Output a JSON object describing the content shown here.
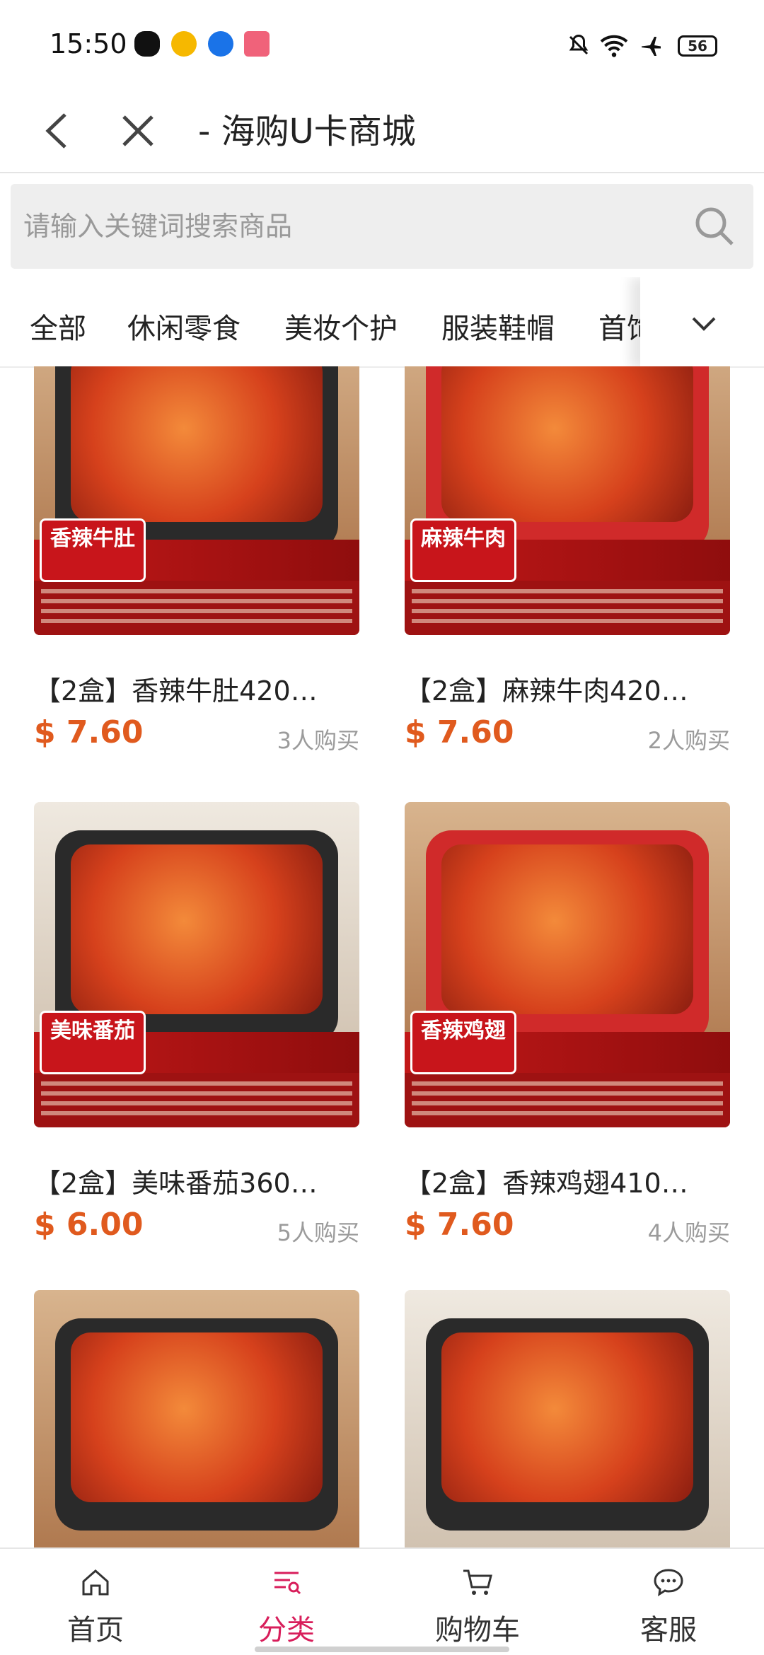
{
  "status_bar": {
    "time": "15:50",
    "battery": "56"
  },
  "header": {
    "title": "- 海购U卡商城"
  },
  "search": {
    "placeholder": "请输入关键词搜索商品"
  },
  "tabs": [
    "全部",
    "休闲零食",
    "美妆个护",
    "服装鞋帽",
    "首饰"
  ],
  "products": [
    {
      "name": "【2盒】香辣牛肚420…",
      "price": "$ 7.60",
      "sold": "3人购买",
      "badge": "香辣牛肚"
    },
    {
      "name": "【2盒】麻辣牛肉420…",
      "price": "$ 7.60",
      "sold": "2人购买",
      "badge": "麻辣牛肉"
    },
    {
      "name": "【2盒】美味番茄360…",
      "price": "$ 6.00",
      "sold": "5人购买",
      "badge": "美味番茄"
    },
    {
      "name": "【2盒】香辣鸡翅410…",
      "price": "$ 7.60",
      "sold": "4人购买",
      "badge": "香辣鸡翅"
    },
    {
      "name": "",
      "price": "",
      "sold": "",
      "badge": ""
    },
    {
      "name": "",
      "price": "",
      "sold": "",
      "badge": ""
    }
  ],
  "bottom_nav": [
    {
      "label": "首页",
      "icon": "home-icon",
      "active": false
    },
    {
      "label": "分类",
      "icon": "category-icon",
      "active": true
    },
    {
      "label": "购物车",
      "icon": "cart-icon",
      "active": false
    },
    {
      "label": "客服",
      "icon": "chat-icon",
      "active": false
    }
  ],
  "colors": {
    "price": "#e05a1e",
    "active_nav": "#d81e5b"
  }
}
